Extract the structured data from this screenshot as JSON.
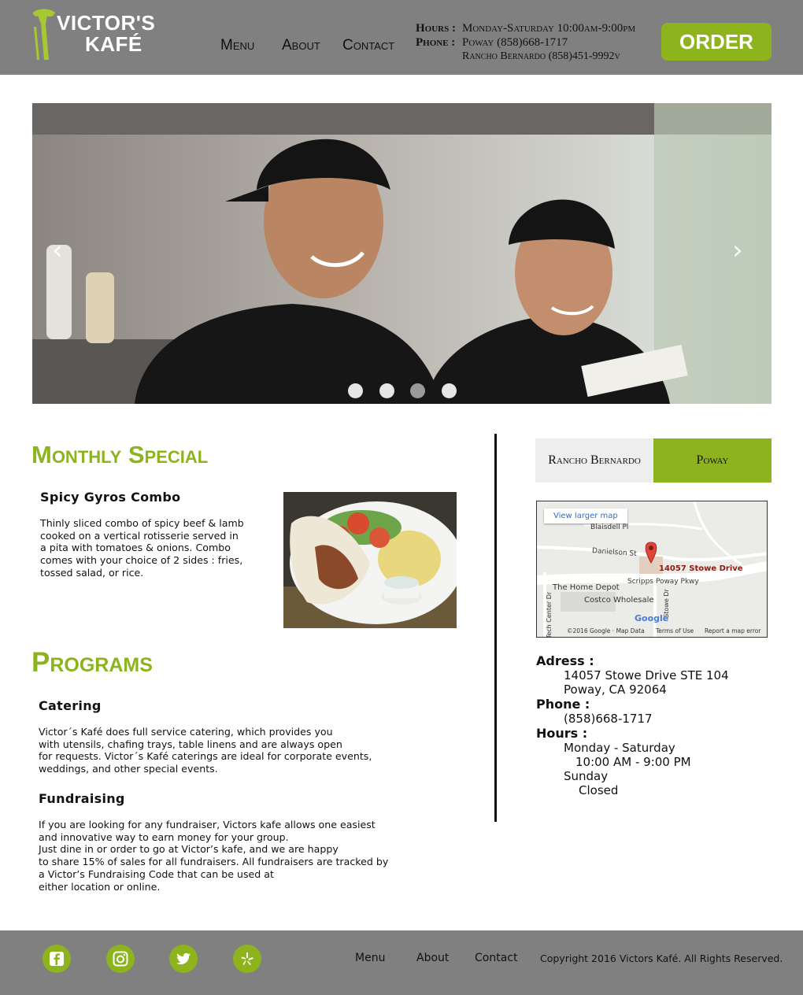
{
  "colors": {
    "header_bg": "#808080",
    "accent": "#8db31d",
    "footer_bg": "#808080"
  },
  "header": {
    "logo_line1": "VICTOR'S",
    "logo_line2": "KAFÉ",
    "nav": [
      "Menu",
      "About",
      "Contact"
    ],
    "hours_label": "Hours :",
    "hours_value": "Monday-Saturday 10:00am-9:00pm",
    "phone_label": "Phone :",
    "phone_poway": "Poway (858)668-1717",
    "phone_rancho": "Rancho Bernardo (858)451-9992v",
    "order_label": "ORDER"
  },
  "hero": {
    "prev_icon": "‹",
    "next_icon": "›",
    "slide_count": 4,
    "active_slide": 3
  },
  "special": {
    "section_title": "Monthly Special",
    "item_title": "Spicy Gyros Combo",
    "item_description": "Thinly sliced combo of spicy beef & lamb\ncooked on a vertical rotisserie served in\na pita with tomatoes &  onions. Combo\ncomes with your choice of 2 sides : fries,\ntossed salad, or rice."
  },
  "programs": {
    "section_title": "Programs",
    "catering_title": "Catering",
    "catering_text": "Victor´s Kafé does full service catering, which provides you\nwith utensils, chafing trays, table linens and are always open\nfor requests. Victor´s Kafé caterings are ideal for corporate events,\nweddings, and other special events.",
    "fundraising_title": "Fundraising",
    "fundraising_text": "If you are looking for any fundraiser, Victors kafe allows one easiest\nand innovative way to earn money for your group.\nJust dine in or order to go at Victor’s kafe, and we are happy\nto share 15% of sales for all fundraisers. All fundraisers are tracked by\na Victor’s Fundraising Code that can be used at\neither location or online."
  },
  "locations": {
    "tabs": [
      "Rancho Bernardo",
      "Poway"
    ],
    "active_tab": "Poway"
  },
  "map": {
    "view_larger": "View larger map",
    "pin_label": "14057 Stowe Drive",
    "streets": [
      "Blaisdell Pl",
      "Danielson St",
      "Scripps Poway Pkwy",
      "Tech Center Dr",
      "Stowe Dr"
    ],
    "places": [
      "The Home Depot",
      "Costco Wholesale"
    ],
    "brand": "Google",
    "attribution": "©2016 Google · Map Data",
    "terms": "Terms of Use",
    "report": "Report a map error"
  },
  "contact": {
    "address_label": "Adress :",
    "address_line1": "14057 Stowe Drive STE 104",
    "address_line2": "Poway, CA 92064",
    "phone_label": "Phone :",
    "phone_value": "(858)668-1717",
    "hours_label": "Hours :",
    "hours_days1": "Monday - Saturday",
    "hours_time1": "10:00 AM - 9:00 PM",
    "hours_days2": "Sunday",
    "hours_time2": "Closed"
  },
  "footer": {
    "social_icons": [
      "facebook-icon",
      "instagram-icon",
      "twitter-icon",
      "yelp-icon"
    ],
    "links": [
      "Menu",
      "About",
      "Contact"
    ],
    "copyright": "Copyright 2016 Victors Kafé. All Rights Reserved."
  }
}
